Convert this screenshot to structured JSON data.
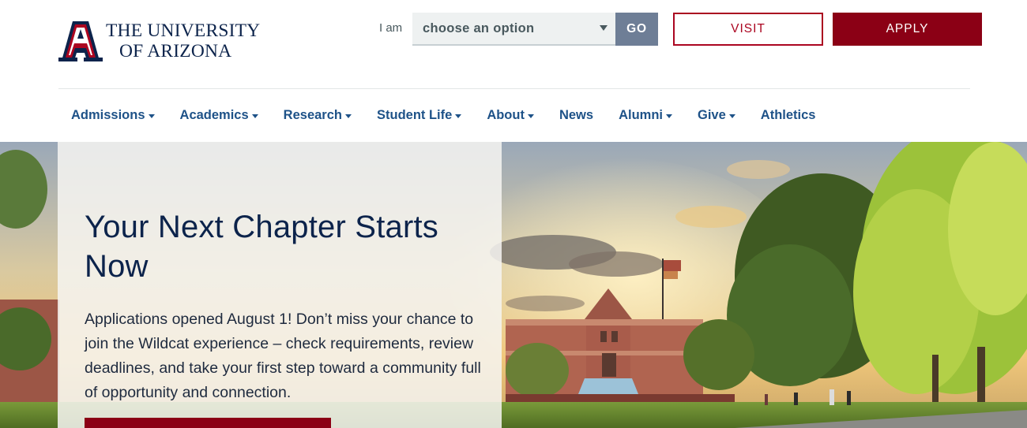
{
  "header": {
    "logo": {
      "line1": "THE UNIVERSITY",
      "line2": "OF ARIZONA",
      "icon": "block-a-logo-icon"
    },
    "selector": {
      "label": "I am",
      "value": "choose an option",
      "icon": "caret-down-icon"
    },
    "go_label": "GO",
    "visit_label": "VISIT",
    "apply_label": "APPLY"
  },
  "nav": {
    "items": [
      {
        "label": "Admissions",
        "has_menu": true
      },
      {
        "label": "Academics",
        "has_menu": true
      },
      {
        "label": "Research",
        "has_menu": true
      },
      {
        "label": "Student Life",
        "has_menu": true
      },
      {
        "label": "About",
        "has_menu": true
      },
      {
        "label": "News",
        "has_menu": false
      },
      {
        "label": "Alumni",
        "has_menu": true
      },
      {
        "label": "Give",
        "has_menu": true
      },
      {
        "label": "Athletics",
        "has_menu": false
      }
    ]
  },
  "hero": {
    "title": "Your Next Chapter Starts Now",
    "body": "Applications opened August 1! Don’t miss your chance to join the Wildcat experience – check requirements, review deadlines, and take your first step toward a community full of opportunity and connection."
  },
  "colors": {
    "navy": "#0c234b",
    "red": "#ab0520",
    "dark_red": "#8b0015",
    "nav_blue": "#1e5288",
    "go_gray": "#6e7e96"
  }
}
